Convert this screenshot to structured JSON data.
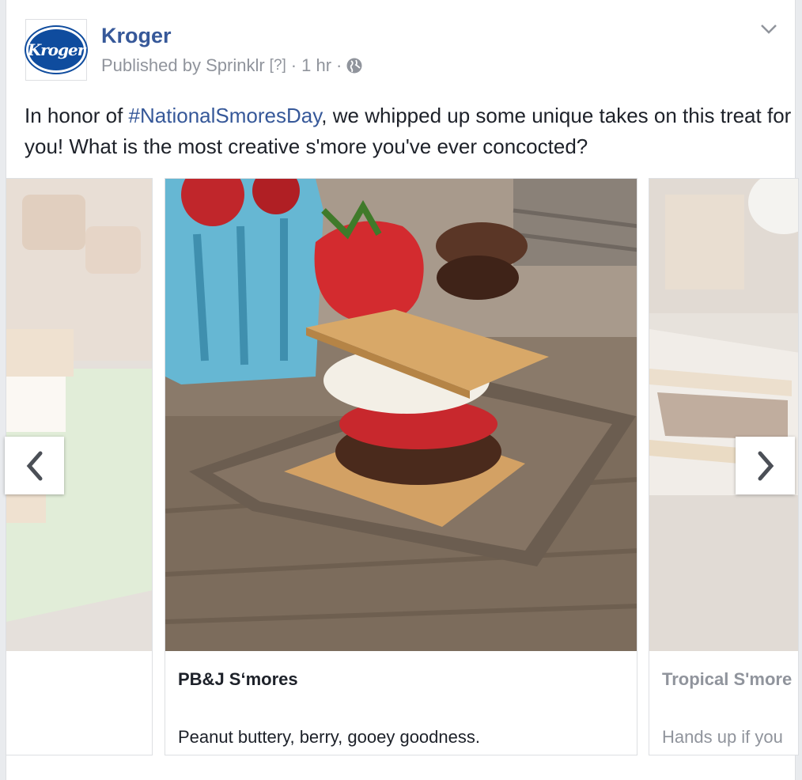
{
  "post": {
    "page_name": "Kroger",
    "logo_text": "Kroger",
    "published_by": "Published by Sprinklr",
    "help_marker": "[?]",
    "separator": "·",
    "time": "1 hr",
    "text_before": "In honor of ",
    "hashtag": "#NationalSmoresDay",
    "text_after": ", we whipped up some unique takes on this treat for you! What is the most creative s'more you've ever concocted?"
  },
  "carousel": {
    "cards": [
      {
        "title": "",
        "description": ""
      },
      {
        "title": "PB&J S‘mores",
        "description": "Peanut buttery, berry, gooey goodness."
      },
      {
        "title": "Tropical S'more",
        "description": "Hands up if you"
      }
    ]
  },
  "icons": {
    "prev": "chevron-left-icon",
    "next": "chevron-right-icon",
    "options": "chevron-down-icon",
    "audience": "globe-icon"
  },
  "colors": {
    "link": "#365899",
    "meta": "#90949c",
    "text": "#1d2129",
    "brand": "#0f4c9e"
  }
}
